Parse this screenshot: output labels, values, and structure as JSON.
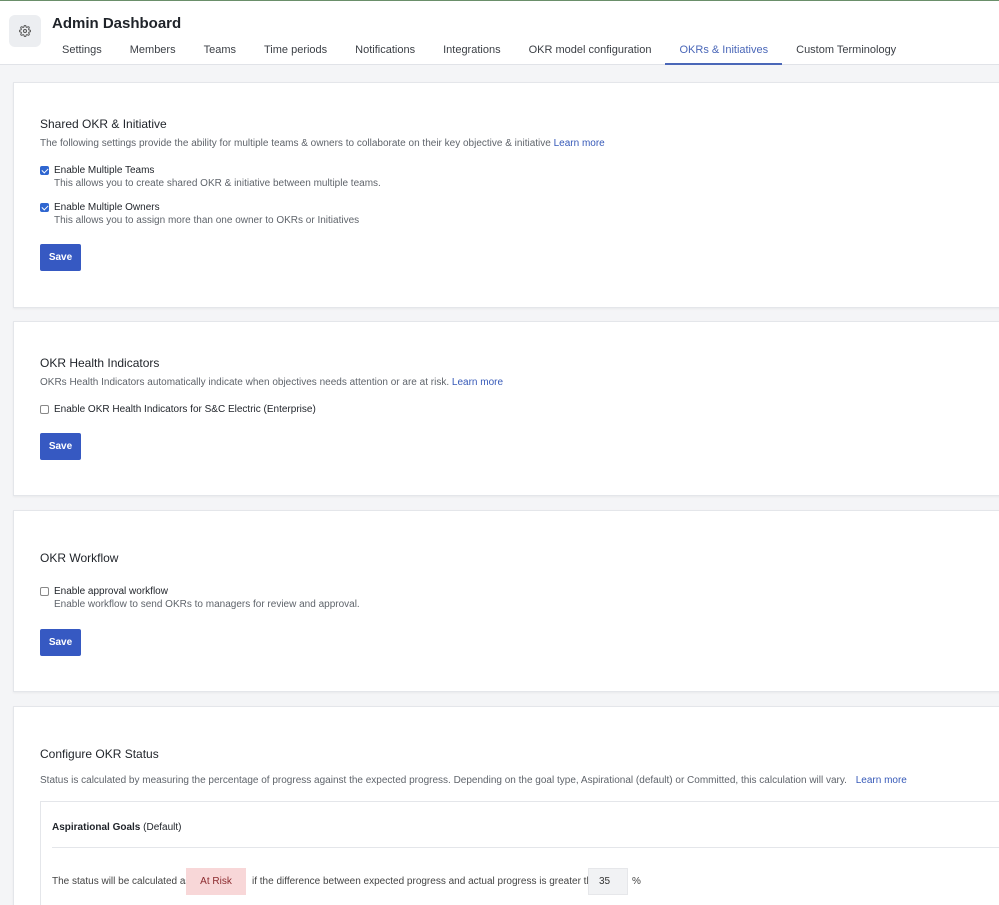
{
  "header": {
    "title": "Admin Dashboard",
    "tabs": [
      {
        "label": "Settings"
      },
      {
        "label": "Members"
      },
      {
        "label": "Teams"
      },
      {
        "label": "Time periods"
      },
      {
        "label": "Notifications"
      },
      {
        "label": "Integrations"
      },
      {
        "label": "OKR model configuration"
      },
      {
        "label": "OKRs & Initiatives",
        "active": true
      },
      {
        "label": "Custom Terminology"
      }
    ]
  },
  "shared": {
    "title": "Shared OKR & Initiative",
    "description": "The following settings provide the ability for multiple teams & owners to collaborate on their key objective & initiative",
    "learn_more": "Learn more",
    "options": [
      {
        "label": "Enable Multiple Teams",
        "sub": "This allows you to create shared OKR & initiative between multiple teams.",
        "checked": true
      },
      {
        "label": "Enable Multiple Owners",
        "sub": "This allows you to assign more than one owner to OKRs or Initiatives",
        "checked": true
      }
    ],
    "save": "Save"
  },
  "health": {
    "title": "OKR Health Indicators",
    "description": "OKRs Health Indicators automatically indicate when objectives needs attention or are at risk.",
    "learn_more": "Learn more",
    "option": {
      "label": "Enable OKR Health Indicators for S&C Electric (Enterprise)",
      "checked": false
    },
    "save": "Save"
  },
  "workflow": {
    "title": "OKR Workflow",
    "option": {
      "label": "Enable approval workflow",
      "sub": "Enable workflow to send OKRs to managers for review and approval.",
      "checked": false
    },
    "save": "Save"
  },
  "status": {
    "title": "Configure OKR Status",
    "description": "Status is calculated by measuring the percentage of progress against the expected progress. Depending on the goal type, Aspirational (default) or Committed, this calculation will vary.",
    "learn_more": "Learn more",
    "goal_heading": "Aspirational Goals",
    "goal_suffix": "(Default)",
    "line_prefix": "The status will be calculated as",
    "badge": "At Risk",
    "line_middle": "if the difference between expected progress and actual progress is greater than",
    "value": "35",
    "unit": "%"
  },
  "colors": {
    "accent": "#4a67b8",
    "button": "#3659c2",
    "badge_bg": "#f8d7d8"
  }
}
